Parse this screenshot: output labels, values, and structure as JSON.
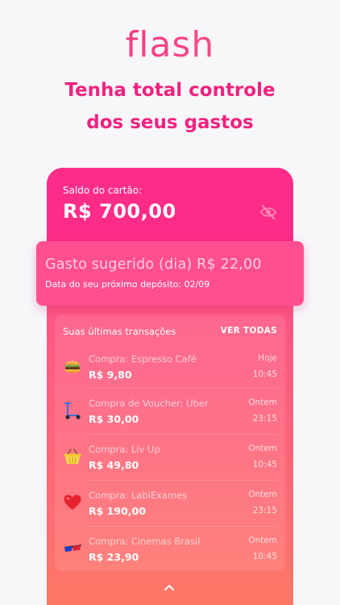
{
  "brand": {
    "logo_text": "flash"
  },
  "headline": {
    "line1": "Tenha total controle",
    "line2": "dos seus gastos"
  },
  "card": {
    "balance_label": "Saldo do cartão:",
    "balance_value": "R$ 700,00"
  },
  "suggested": {
    "title": "Gasto sugerido (dia) R$ 22,00",
    "subtitle": "Data do seu próximo depósito: 02/09"
  },
  "transactions": {
    "title": "Suas últimas transações",
    "see_all_label": "VER TODAS",
    "items": [
      {
        "icon": "hamburger-icon",
        "name": "Compra: Espresso Café",
        "amount": "R$ 9,80",
        "day": "Hoje",
        "time": "10:45"
      },
      {
        "icon": "scooter-icon",
        "name": "Compra de Voucher: Uber",
        "amount": "R$ 30,00",
        "day": "Ontem",
        "time": "23:15"
      },
      {
        "icon": "basket-icon",
        "name": "Compra: Liv Up",
        "amount": "R$ 49,80",
        "day": "Ontem",
        "time": "10:45"
      },
      {
        "icon": "heart-icon",
        "name": "Compra: LabiExames",
        "amount": "R$ 190,00",
        "day": "Ontem",
        "time": "23:15"
      },
      {
        "icon": "3d-glasses-icon",
        "name": "Compra: Cinemas Brasil",
        "amount": "R$ 23,90",
        "day": "Ontem",
        "time": "10:45"
      }
    ]
  },
  "colors": {
    "brand_pink": "#f0227f",
    "card_top": "#fd2c88",
    "card_bottom": "#ff7a62"
  }
}
